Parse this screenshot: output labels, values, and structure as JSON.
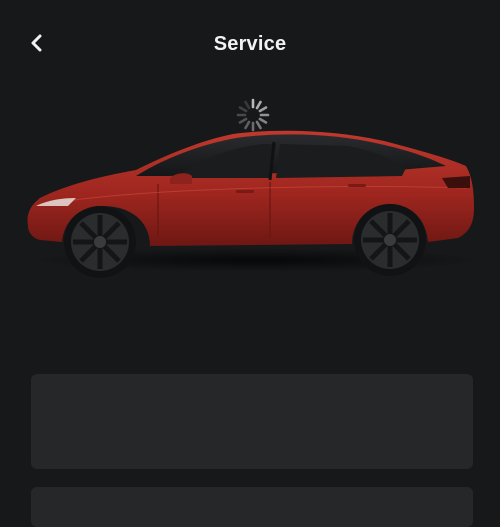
{
  "header": {
    "title": "Service",
    "back_icon": "chevron-left-icon"
  },
  "loading": {
    "icon": "loading-spinner-icon"
  },
  "vehicle": {
    "icon": "car-side-view",
    "paint_color": "#a82a22",
    "wheel_color": "#2b2c2e"
  },
  "colors": {
    "background": "#17181a",
    "card": "#262729",
    "text": "#f2f2f2"
  }
}
